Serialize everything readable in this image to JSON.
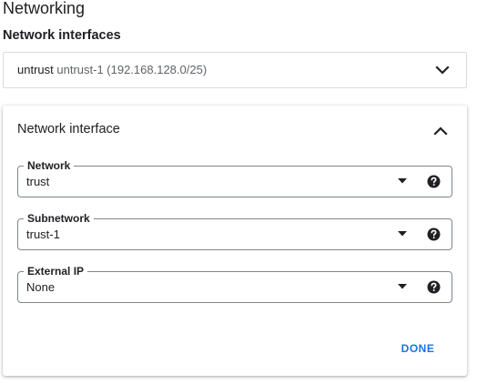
{
  "section": {
    "title": "Networking",
    "subtitle": "Network interfaces"
  },
  "collapsed_interface": {
    "name": "untrust",
    "detail": "untrust-1 (192.168.128.0/25)",
    "icon": "chevron-down-icon"
  },
  "expanded_card": {
    "title": "Network interface",
    "icon": "chevron-up-icon",
    "fields": [
      {
        "label": "Network",
        "value": "trust",
        "icons": [
          "dropdown-arrow-icon",
          "help-icon"
        ]
      },
      {
        "label": "Subnetwork",
        "value": "trust-1",
        "icons": [
          "dropdown-arrow-icon",
          "help-icon"
        ]
      },
      {
        "label": "External IP",
        "value": "None",
        "icons": [
          "dropdown-arrow-icon",
          "help-icon"
        ]
      }
    ],
    "done_label": "DONE"
  },
  "colors": {
    "accent": "#1a73e8",
    "text": "#202124",
    "secondary_text": "#5f6368",
    "border": "#dadce0",
    "field_border": "#80868b"
  }
}
